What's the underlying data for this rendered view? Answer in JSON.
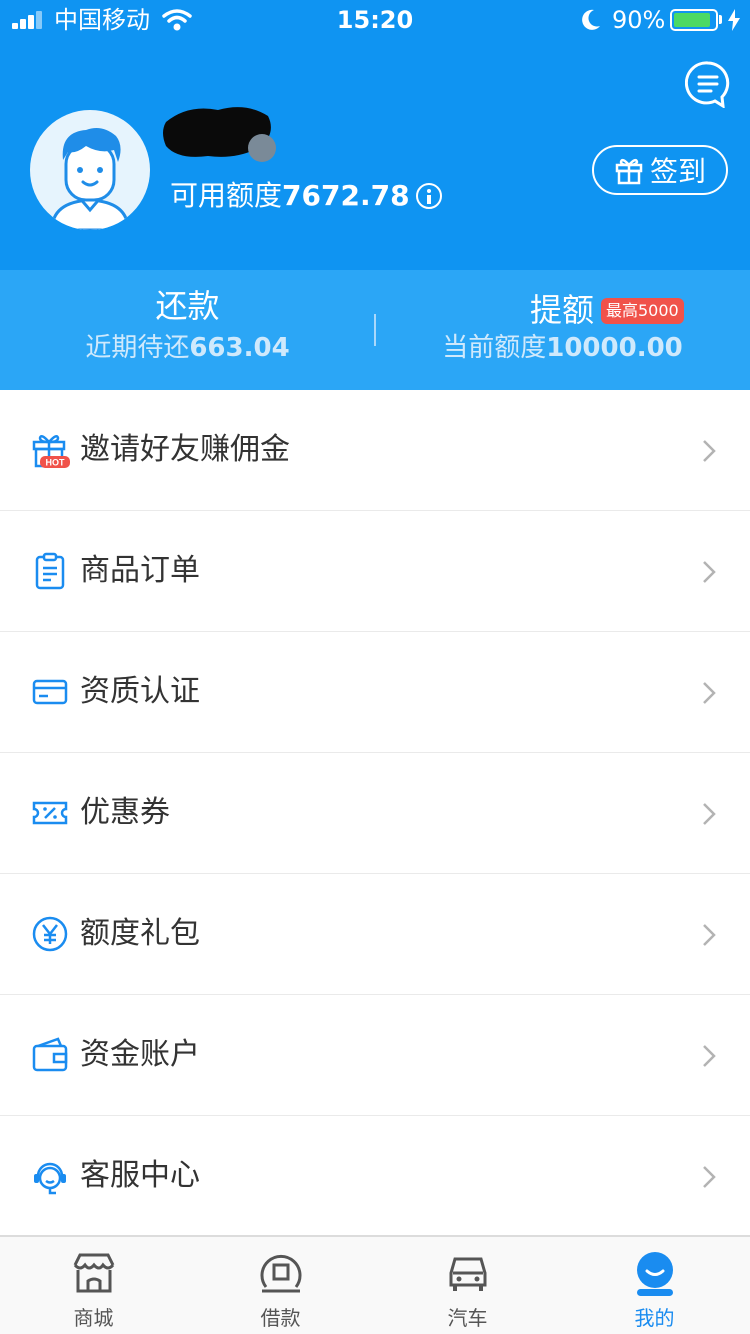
{
  "status_bar": {
    "carrier": "中国移动",
    "time": "15:20",
    "battery": "90%",
    "battery_level": 0.9
  },
  "header": {
    "credit_label": "可用额度",
    "credit_amount": "7672.78",
    "signin_label": "签到"
  },
  "summary": {
    "repay_title": "还款",
    "repay_desc_label": "近期待还",
    "repay_desc_amount": "663.04",
    "raise_title": "提额",
    "raise_badge": "最高5000",
    "raise_desc_label": "当前额度",
    "raise_desc_amount": "10000.00"
  },
  "menu": {
    "items": [
      {
        "label": "邀请好友赚佣金",
        "icon": "gift-hot-icon",
        "badge": "HOT"
      },
      {
        "label": "商品订单",
        "icon": "clipboard-icon"
      },
      {
        "label": "资质认证",
        "icon": "card-icon"
      },
      {
        "label": "优惠券",
        "icon": "coupon-icon"
      },
      {
        "label": "额度礼包",
        "icon": "yen-circle-icon"
      },
      {
        "label": "资金账户",
        "icon": "wallet-icon"
      },
      {
        "label": "客服中心",
        "icon": "headset-icon"
      }
    ]
  },
  "tabbar": {
    "tabs": [
      {
        "label": "商城",
        "icon": "store-icon"
      },
      {
        "label": "借款",
        "icon": "loan-icon"
      },
      {
        "label": "汽车",
        "icon": "car-icon"
      },
      {
        "label": "我的",
        "icon": "profile-icon"
      }
    ],
    "active": "我的"
  },
  "colors": {
    "primary": "#0f94f2",
    "primary_light": "#2ba6f6",
    "badge_red": "#f0524a",
    "active_tab": "#1a8cf0"
  }
}
